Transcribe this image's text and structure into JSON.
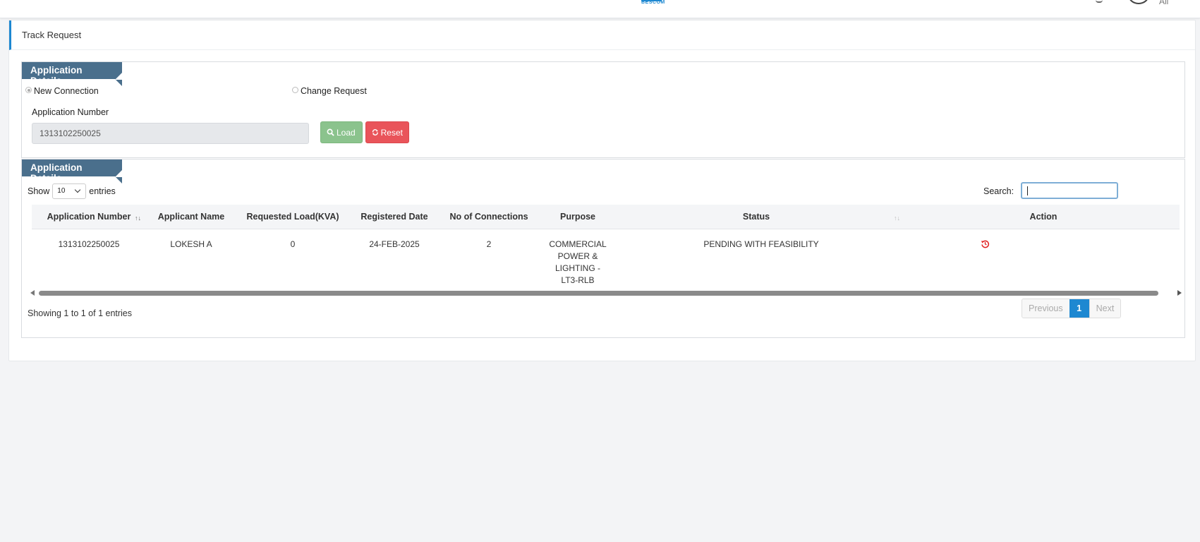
{
  "topbar": {
    "logo_text": "BESCOM",
    "user_label": "Ali"
  },
  "page": {
    "title": "Track Request"
  },
  "section1": {
    "tag": "Application Details",
    "radio_new": "New Connection",
    "radio_change": "Change Request",
    "selected": "New Connection",
    "field_label": "Application Number",
    "app_number_value": "1313102250025",
    "load_label": "Load",
    "reset_label": "Reset"
  },
  "section2": {
    "tag": "Application Details",
    "show_label": "Show",
    "entries_value": "10",
    "entries_label": "entries",
    "search_label": "Search:",
    "search_value": ""
  },
  "table": {
    "headers": [
      "Application Number",
      "Applicant Name",
      "Requested Load(KVA)",
      "Registered Date",
      "No of Connections",
      "Purpose",
      "Status",
      "Action"
    ],
    "rows": [
      {
        "application_number": "1313102250025",
        "applicant_name": "LOKESH A",
        "requested_load": "0",
        "registered_date": "24-FEB-2025",
        "connections": "2",
        "purpose": "COMMERCIAL POWER & LIGHTING - LT3-RLB",
        "status": "PENDING WITH FEASIBILITY",
        "action_icon": "history-icon"
      }
    ]
  },
  "footer": {
    "info": "Showing 1 to 1 of 1 entries",
    "previous": "Previous",
    "page": "1",
    "next": "Next"
  },
  "colors": {
    "accent": "#1e88d1",
    "section_tag": "#4a6f8c",
    "load_button": "#8bc38d",
    "reset_button": "#e9545a",
    "action_icon": "#e02020"
  }
}
